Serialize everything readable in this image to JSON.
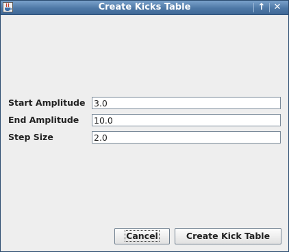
{
  "window": {
    "title": "Create Kicks Table",
    "maximize_glyph": "↑",
    "close_glyph": "✕"
  },
  "form": {
    "rows": [
      {
        "label": "Start Amplitude",
        "value": "3.0"
      },
      {
        "label": "End Amplitude",
        "value": "10.0"
      },
      {
        "label": "Step Size",
        "value": "2.0"
      }
    ]
  },
  "buttons": {
    "cancel_label": "Cancel",
    "create_label": "Create Kick Table"
  }
}
